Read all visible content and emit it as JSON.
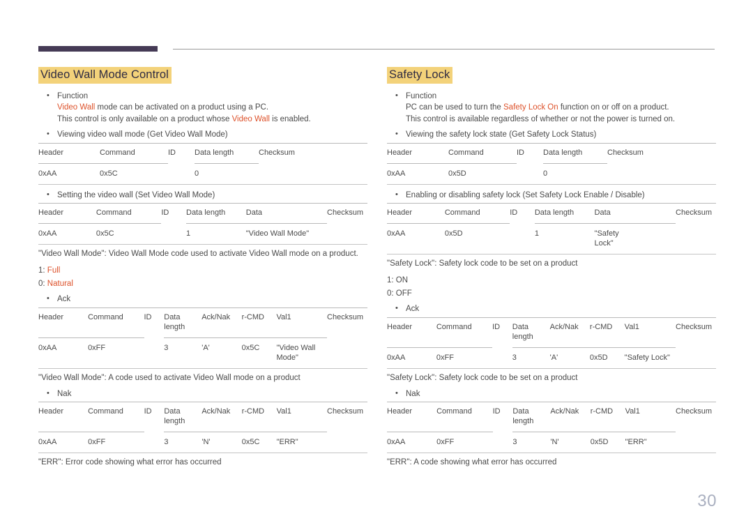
{
  "page": {
    "number": "30",
    "accent_color": "#dd512a",
    "highlight_color": "#f3d27a",
    "rule_color": "#453a55"
  },
  "left": {
    "title": "Video Wall Mode Control",
    "function_label": "Function",
    "function_line1_accent": "Video Wall",
    "function_line1_rest": " mode can be activated on a product using a PC.",
    "function_line2_pre": "This control is only available on a product whose ",
    "function_line2_accent": "Video Wall",
    "function_line2_post": " is enabled.",
    "get_bullet": "Viewing video wall mode (Get Video Wall Mode)",
    "get_table": {
      "headers": [
        "Header",
        "Command",
        "ID",
        "Data length",
        "Checksum"
      ],
      "row": [
        "0xAA",
        "0x5C",
        "",
        "0",
        ""
      ]
    },
    "set_bullet": "Setting the video wall (Set Video Wall Mode)",
    "set_table": {
      "headers": [
        "Header",
        "Command",
        "ID",
        "Data length",
        "Data",
        "Checksum"
      ],
      "row": [
        "0xAA",
        "0x5C",
        "",
        "1",
        "\"Video Wall Mode\"",
        ""
      ]
    },
    "set_note": "\"Video Wall Mode\": Video Wall Mode code used to activate Video Wall mode on a product.",
    "values": [
      {
        "key": "1: ",
        "value": "Full",
        "accent": true
      },
      {
        "key": "0: ",
        "value": "Natural",
        "accent": true
      }
    ],
    "ack_bullet": "Ack",
    "ack_table": {
      "headers": [
        "Header",
        "Command",
        "ID",
        "Data\nlength",
        "Ack/Nak",
        "r-CMD",
        "Val1",
        "Checksum"
      ],
      "row": [
        "0xAA",
        "0xFF",
        "",
        "3",
        "'A'",
        "0x5C",
        "\"Video Wall\nMode\"",
        ""
      ]
    },
    "ack_note": "\"Video Wall Mode\": A code used to activate Video Wall mode on a product",
    "nak_bullet": "Nak",
    "nak_table": {
      "headers": [
        "Header",
        "Command",
        "ID",
        "Data\nlength",
        "Ack/Nak",
        "r-CMD",
        "Val1",
        "Checksum"
      ],
      "row": [
        "0xAA",
        "0xFF",
        "",
        "3",
        "'N'",
        "0x5C",
        "\"ERR\"",
        ""
      ]
    },
    "nak_note": "\"ERR\": Error code showing what error has occurred"
  },
  "right": {
    "title": "Safety Lock",
    "function_label": "Function",
    "function_line1_pre": "PC can be used to turn the ",
    "function_line1_accent": "Safety Lock On",
    "function_line1_post": " function on or off on a product.",
    "function_line2": "This control is available regardless of whether or not the power is turned on.",
    "get_bullet": "Viewing the safety lock state (Get Safety Lock Status)",
    "get_table": {
      "headers": [
        "Header",
        "Command",
        "ID",
        "Data length",
        "Checksum"
      ],
      "row": [
        "0xAA",
        "0x5D",
        "",
        "0",
        ""
      ]
    },
    "set_bullet": "Enabling or disabling safety lock (Set Safety Lock Enable / Disable)",
    "set_table": {
      "headers": [
        "Header",
        "Command",
        "ID",
        "Data length",
        "Data",
        "Checksum"
      ],
      "row": [
        "0xAA",
        "0x5D",
        "",
        "1",
        "\"Safety\nLock\"",
        ""
      ]
    },
    "set_note": "\"Safety Lock\": Safety lock code to be set on a product",
    "values": [
      {
        "key": "1: ",
        "value": "ON",
        "accent": false
      },
      {
        "key": "0: ",
        "value": "OFF",
        "accent": false
      }
    ],
    "ack_bullet": "Ack",
    "ack_table": {
      "headers": [
        "Header",
        "Command",
        "ID",
        "Data\nlength",
        "Ack/Nak",
        "r-CMD",
        "Val1",
        "Checksum"
      ],
      "row": [
        "0xAA",
        "0xFF",
        "",
        "3",
        "'A'",
        "0x5D",
        "\"Safety Lock\"",
        ""
      ]
    },
    "ack_note": "\"Safety Lock\": Safety lock code to be set on a product",
    "nak_bullet": "Nak",
    "nak_table": {
      "headers": [
        "Header",
        "Command",
        "ID",
        "Data\nlength",
        "Ack/Nak",
        "r-CMD",
        "Val1",
        "Checksum"
      ],
      "row": [
        "0xAA",
        "0xFF",
        "",
        "3",
        "'N'",
        "0x5D",
        "\"ERR\"",
        ""
      ]
    },
    "nak_note": "\"ERR\": A code showing what error has occurred"
  }
}
